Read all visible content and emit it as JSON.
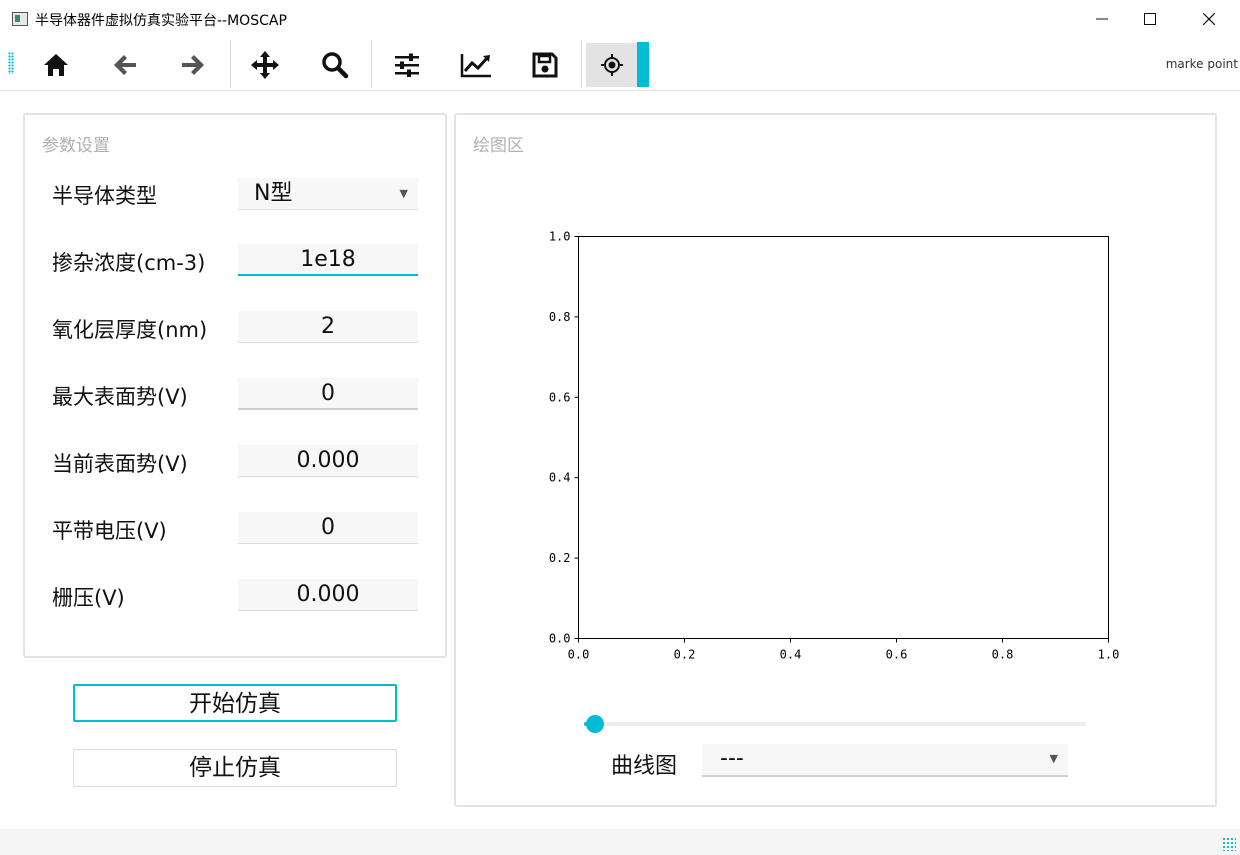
{
  "window": {
    "title": "半导体器件虚拟仿真实验平台--MOSCAP",
    "controls": [
      "minimize",
      "maximize",
      "close"
    ]
  },
  "toolbar": {
    "buttons": [
      {
        "name": "home",
        "icon": "home-icon"
      },
      {
        "name": "back",
        "icon": "arrow-left-icon"
      },
      {
        "name": "forward",
        "icon": "arrow-right-icon"
      },
      {
        "name": "pan",
        "icon": "move-icon"
      },
      {
        "name": "zoom",
        "icon": "search-icon"
      },
      {
        "name": "configure-subplots",
        "icon": "sliders-icon"
      },
      {
        "name": "edit-axis",
        "icon": "line-chart-icon"
      },
      {
        "name": "save",
        "icon": "floppy-disk-icon"
      },
      {
        "name": "marker",
        "icon": "crosshair-icon",
        "active": true
      }
    ],
    "marker_label": "marke point",
    "accent_color": "#00bcd4"
  },
  "params": {
    "title": "参数设置",
    "fields": [
      {
        "label": "半导体类型",
        "value": "N型",
        "kind": "select"
      },
      {
        "label": "掺杂浓度(cm-3)",
        "value": "1e18",
        "kind": "input",
        "focused": true
      },
      {
        "label": "氧化层厚度(nm)",
        "value": "2",
        "kind": "readonly"
      },
      {
        "label": "最大表面势(V)",
        "value": "0",
        "kind": "input"
      },
      {
        "label": "当前表面势(V)",
        "value": "0.000",
        "kind": "readonly"
      },
      {
        "label": "平带电压(V)",
        "value": "0",
        "kind": "readonly"
      },
      {
        "label": "栅压(V)",
        "value": "0.000",
        "kind": "readonly"
      }
    ]
  },
  "actions": {
    "start_label": "开始仿真",
    "stop_label": "停止仿真"
  },
  "plot_area": {
    "title": "绘图区",
    "slider_value": 0,
    "curve_label": "曲线图",
    "curve_value": "---"
  },
  "chart_data": {
    "type": "line",
    "series": [],
    "title": "",
    "xlabel": "",
    "ylabel": "",
    "xlim": [
      0,
      1
    ],
    "ylim": [
      0,
      1
    ],
    "xticks": [
      "0.0",
      "0.2",
      "0.4",
      "0.6",
      "0.8",
      "1.0"
    ],
    "yticks": [
      "0.0",
      "0.2",
      "0.4",
      "0.6",
      "0.8",
      "1.0"
    ],
    "grid": false
  }
}
